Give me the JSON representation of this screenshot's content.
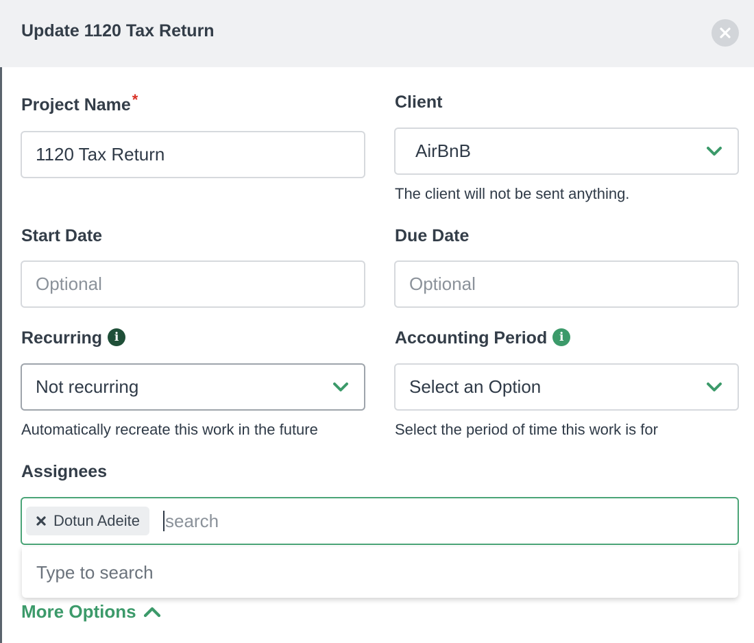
{
  "modal": {
    "title": "Update 1120 Tax Return"
  },
  "project_name": {
    "label": "Project Name",
    "required_mark": "*",
    "value": "1120 Tax Return"
  },
  "client": {
    "label": "Client",
    "value": "AirBnB",
    "helper": "The client will not be sent anything."
  },
  "start_date": {
    "label": "Start Date",
    "placeholder": "Optional"
  },
  "due_date": {
    "label": "Due Date",
    "placeholder": "Optional"
  },
  "recurring": {
    "label": "Recurring",
    "value": "Not recurring",
    "helper": "Automatically recreate this work in the future"
  },
  "accounting_period": {
    "label": "Accounting Period",
    "value": "Select an Option",
    "helper": "Select the period of time this work is for"
  },
  "assignees": {
    "label": "Assignees",
    "chips": [
      "Dotun Adeite"
    ],
    "search_placeholder": "search",
    "dropdown_hint": "Type to search"
  },
  "more_options": {
    "label": "More Options"
  },
  "colors": {
    "accent_green": "#3c9a6a",
    "required_red": "#d93025",
    "header_bg": "#f0f1f3"
  },
  "icons": {
    "close": "close-icon",
    "chevron": "chevron-down-icon",
    "info": "info-icon",
    "chip_remove": "x-icon",
    "more_options": "chevron-up-icon"
  }
}
